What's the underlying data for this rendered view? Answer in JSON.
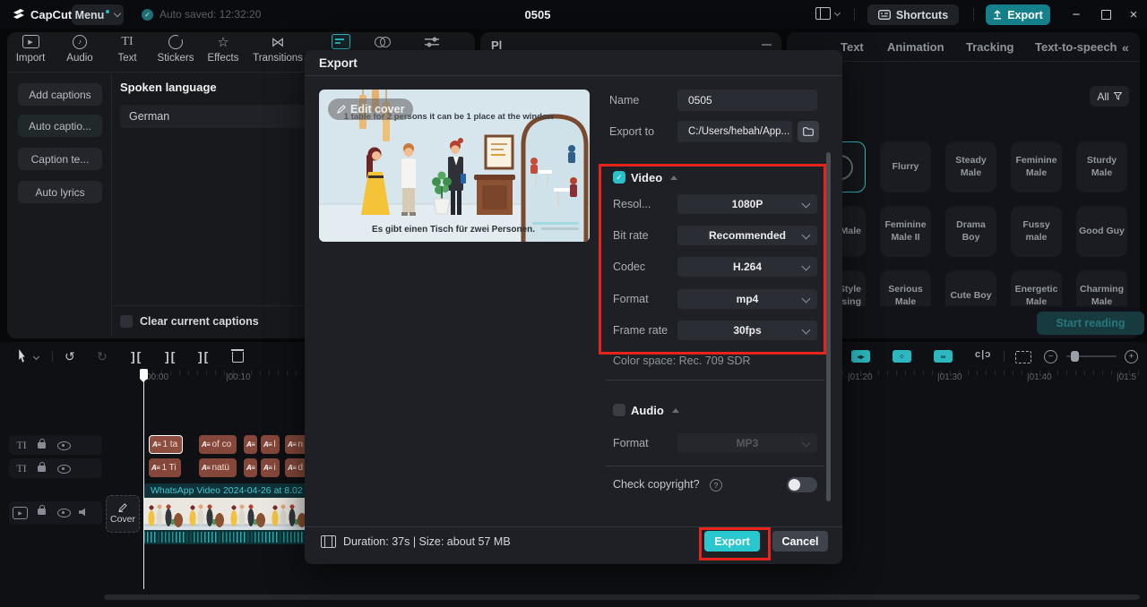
{
  "colors": {
    "accent": "#2bc7cf",
    "annotation_red": "#e8231c",
    "segment_brown": "#84473a"
  },
  "titlebar": {
    "app": "CapCut",
    "menu": "Menu",
    "autosaved": "Auto saved: 12:32:20",
    "title": "0505",
    "shortcuts": "Shortcuts",
    "export": "Export"
  },
  "toolbar": {
    "import": "Import",
    "audio": "Audio",
    "text": "Text",
    "stickers": "Stickers",
    "effects": "Effects",
    "transitions": "Transitions"
  },
  "captions": {
    "items": [
      "Add captions",
      "Auto captio...",
      "Caption te...",
      "Auto lyrics"
    ],
    "spoken_language": "Spoken language",
    "language": "German",
    "clear": "Clear current captions"
  },
  "player": {
    "partial_title": "Pl"
  },
  "tts": {
    "tabs": [
      "Text",
      "Animation",
      "Tracking",
      "Text-to-speech"
    ],
    "collapse": "«",
    "filter": "All",
    "voices": {
      "r1": [
        "",
        "Flurry",
        "Steady Male",
        "Feminine Male",
        "Sturdy Male"
      ],
      "r2": [
        "Male",
        "Feminine Male II",
        "Drama Boy",
        "Fussy male",
        "Good Guy"
      ],
      "r3": [
        "Style tising",
        "Serious Male",
        "Cute Boy",
        "Energetic Male",
        "Charming Male"
      ]
    },
    "start_reading": "Start reading"
  },
  "dialog": {
    "title": "Export",
    "edit_cover": "Edit cover",
    "cover_top_caption": "1 table for 2 persons it can be 1 place at the window",
    "cover_bottom_caption": "Es gibt einen Tisch für zwei Personen.",
    "name_label": "Name",
    "name_value": "0505",
    "export_to_label": "Export to",
    "export_to_value": "C:/Users/hebah/App...",
    "video_label": "Video",
    "rows": [
      {
        "label": "Resol...",
        "value": "1080P"
      },
      {
        "label": "Bit rate",
        "value": "Recommended"
      },
      {
        "label": "Codec",
        "value": "H.264"
      },
      {
        "label": "Format",
        "value": "mp4"
      },
      {
        "label": "Frame rate",
        "value": "30fps"
      }
    ],
    "color_space": "Color space: Rec. 709 SDR",
    "audio_label": "Audio",
    "audio_format_label": "Format",
    "audio_format_value": "MP3",
    "copyright": "Check copyright?",
    "footer_info": "Duration: 37s | Size: about 57 MB",
    "export_btn": "Export",
    "cancel_btn": "Cancel"
  },
  "timeline": {
    "ruler": [
      "00:00",
      "|00:10",
      "|01:20",
      "|01:30",
      "|01:40",
      "|01:5"
    ],
    "track1": [
      "1 ta",
      "of co",
      "",
      "l",
      "n"
    ],
    "track2": [
      "1 Ti",
      "natü",
      "",
      "i",
      "d"
    ],
    "video_title": "WhatsApp Video 2024-04-26 at 8.02",
    "cover_btn": "Cover"
  }
}
